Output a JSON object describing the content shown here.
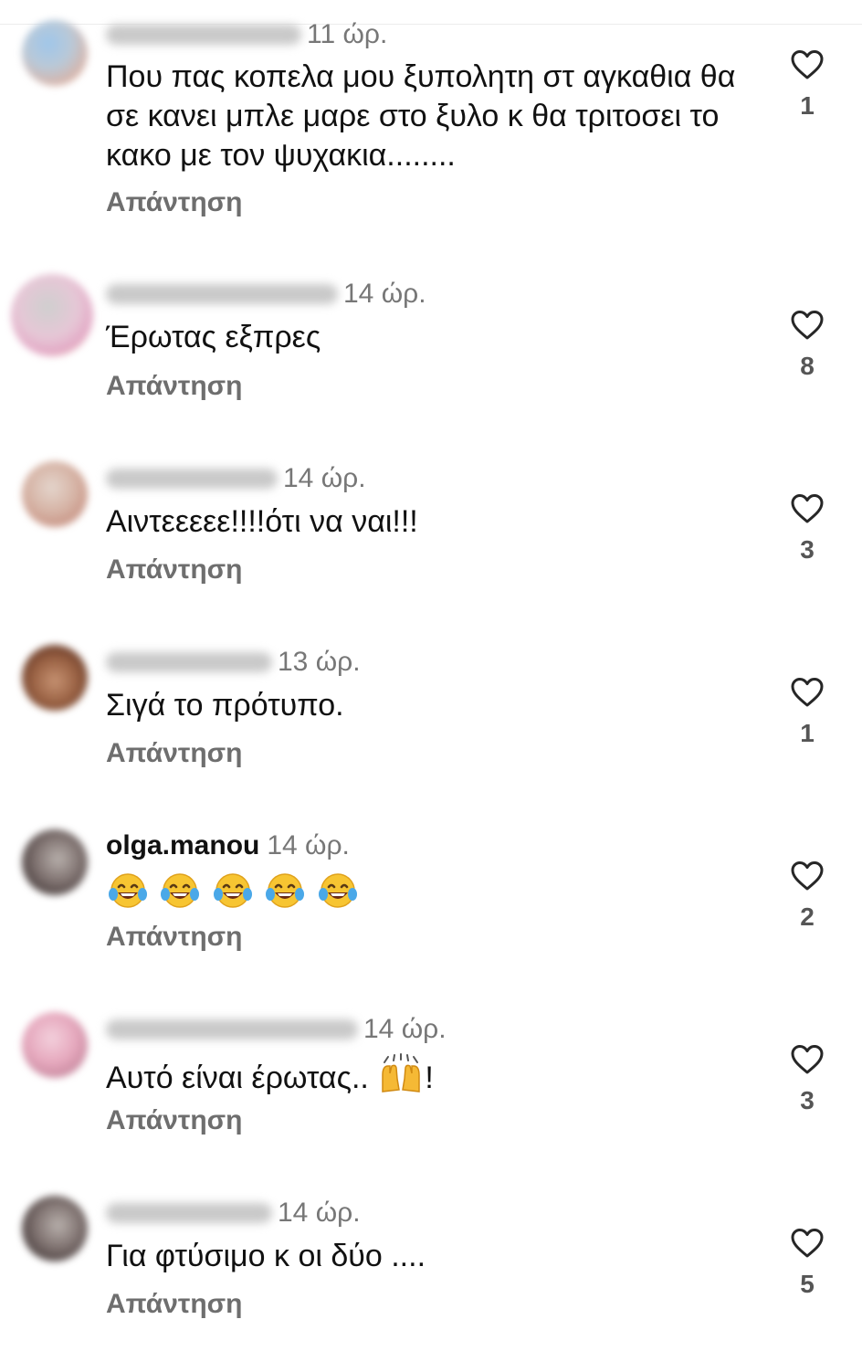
{
  "comments": [
    {
      "username": "",
      "time": "11 ώρ.",
      "text": "Που πας κοπελα μου ξυπολητη στ αγκαθια θα σε κανει μπλε μαρε στο ξυλο κ θα τριτοσει το κακο με τον ψυχακια........",
      "reply_label": "Απάντηση",
      "likes": "1"
    },
    {
      "username": "",
      "time": "14 ώρ.",
      "text": "Έρωτας εξπρες",
      "reply_label": "Απάντηση",
      "likes": "8"
    },
    {
      "username": "",
      "time": "14 ώρ.",
      "text": "Αιντεεεεε!!!!ότι  να ναι!!!",
      "reply_label": "Απάντηση",
      "likes": "3"
    },
    {
      "username": "",
      "time": "13 ώρ.",
      "text": "Σιγά το πρότυπο.",
      "reply_label": "Απάντηση",
      "likes": "1"
    },
    {
      "username": "olga.manou",
      "time": "14 ώρ.",
      "text": "",
      "emoji": "laughing-tears-emoji",
      "reply_label": "Απάντηση",
      "likes": "2"
    },
    {
      "username": "",
      "time": "14 ώρ.",
      "text": "Αυτό είναι έρωτας.. ",
      "text_suffix": "!",
      "emoji": "raised-hands-emoji",
      "reply_label": "Απάντηση",
      "likes": "3"
    },
    {
      "username": "",
      "time": "14 ώρ.",
      "text": "Για φτύσιμο κ οι δύο ....",
      "reply_label": "Απάντηση",
      "likes": "5"
    }
  ],
  "icons": {
    "like": "heart-outline-icon"
  },
  "colors": {
    "text": "#111111",
    "meta": "#777777",
    "reply": "#6e6e6e",
    "heart": "#262626"
  }
}
